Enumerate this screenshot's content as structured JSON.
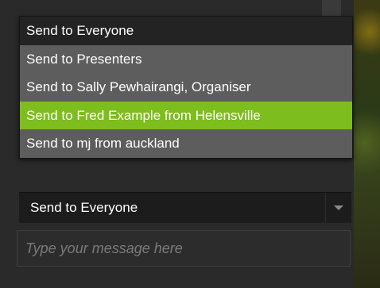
{
  "dropdown": {
    "options": [
      "Send to Everyone",
      "Send to Presenters",
      "Send to Sally Pewhairangi, Organiser",
      "Send to Fred Example from Helensville",
      "Send to mj from auckland"
    ],
    "highlighted_index": 3
  },
  "recipient_select": {
    "value": "Send to Everyone"
  },
  "message": {
    "placeholder": "Type your message here"
  },
  "colors": {
    "highlight": "#7dbd1d",
    "option_bg": "#5d5d5d",
    "first_option_bg": "#232323",
    "select_bg": "#1c1c1c"
  }
}
